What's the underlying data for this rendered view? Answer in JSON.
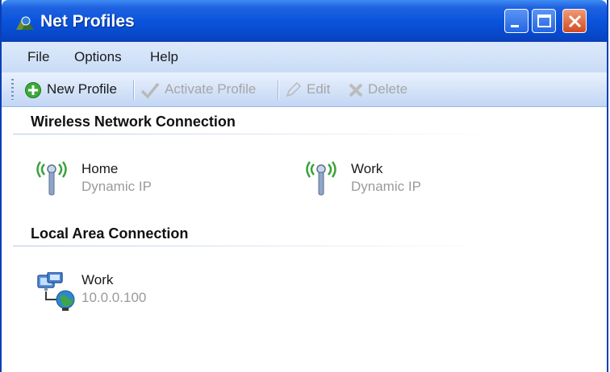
{
  "window": {
    "title": "Net Profiles"
  },
  "menu": {
    "items": [
      "File",
      "Options",
      "Help"
    ]
  },
  "toolbar": {
    "new_profile": "New Profile",
    "activate_profile": "Activate Profile",
    "edit": "Edit",
    "delete": "Delete"
  },
  "sections": [
    {
      "title": "Wireless Network Connection",
      "profiles": [
        {
          "name": "Home",
          "detail": "Dynamic IP",
          "icon": "wireless-antenna-icon"
        },
        {
          "name": "Work",
          "detail": "Dynamic IP",
          "icon": "wireless-antenna-icon"
        }
      ]
    },
    {
      "title": "Local Area Connection",
      "profiles": [
        {
          "name": "Work",
          "detail": "10.0.0.100",
          "icon": "network-computers-icon"
        }
      ]
    }
  ],
  "colors": {
    "titlebar": "#0a54dc",
    "menubar": "#d3e2f8",
    "disabled_text": "#a6a6a6",
    "detail_text": "#9a9a9a"
  }
}
